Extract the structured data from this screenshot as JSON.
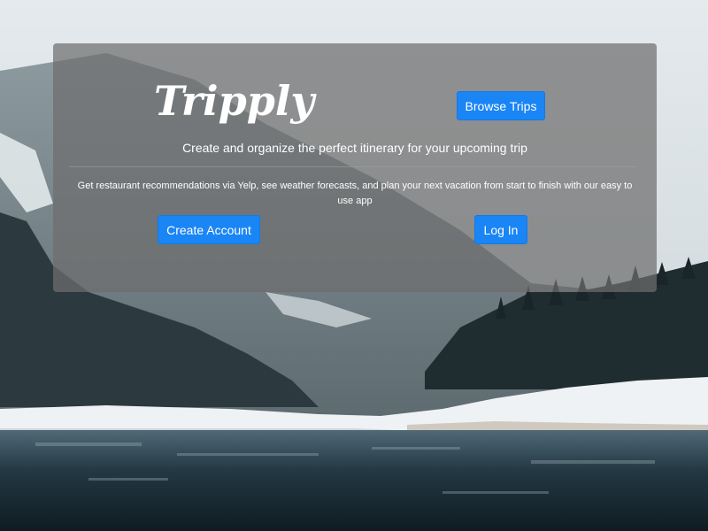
{
  "brand": {
    "logo_text": "Tripply"
  },
  "hero": {
    "tagline": "Create and organize the perfect itinerary for your upcoming trip",
    "description": "Get restaurant recommendations via Yelp, see weather forecasts, and plan your next vacation from start to finish with our easy to use app"
  },
  "buttons": {
    "browse_trips": "Browse Trips",
    "create_account": "Create Account",
    "log_in": "Log In"
  },
  "colors": {
    "primary_button": "#1a85f5",
    "panel_overlay": "rgba(110,110,110,0.72)"
  }
}
